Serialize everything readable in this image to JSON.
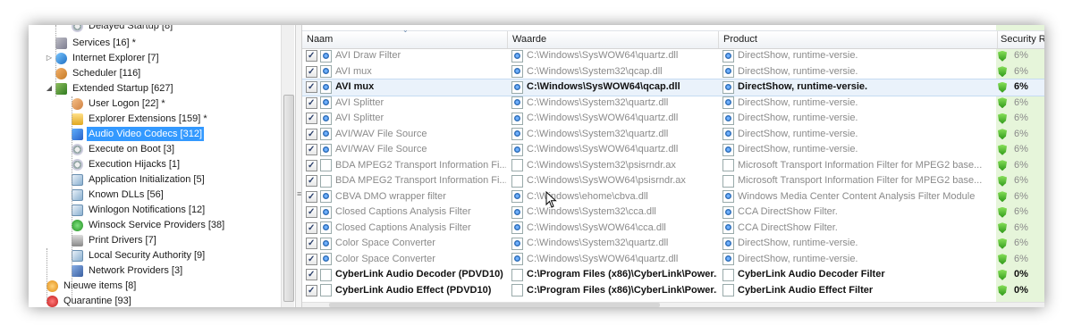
{
  "tree": {
    "items": [
      {
        "label": "Delayed Startup [8]",
        "icon": "gear-icon",
        "level": 2
      },
      {
        "label": "Services [16] *",
        "icon": "services-icon",
        "level": 1
      },
      {
        "label": "Internet Explorer [7]",
        "icon": "internet-explorer-icon",
        "level": 1,
        "expander": "▷"
      },
      {
        "label": "Scheduler [116]",
        "icon": "scheduler-icon",
        "level": 1
      },
      {
        "label": "Extended Startup [627]",
        "icon": "extended-startup-icon",
        "level": 1,
        "expander": "◢"
      },
      {
        "label": "User Logon [22] *",
        "icon": "user-icon",
        "level": 2
      },
      {
        "label": "Explorer Extensions [159] *",
        "icon": "folder-icon",
        "level": 2
      },
      {
        "label": "Audio Video Codecs [312]",
        "icon": "audio-video-icon",
        "level": 2,
        "selected": true
      },
      {
        "label": "Execute on Boot [3]",
        "icon": "gear-icon",
        "level": 2
      },
      {
        "label": "Execution Hijacks [1]",
        "icon": "gear-icon",
        "level": 2
      },
      {
        "label": "Application Initialization [5]",
        "icon": "dll-icon",
        "level": 2
      },
      {
        "label": "Known DLLs [56]",
        "icon": "dll-icon",
        "level": 2
      },
      {
        "label": "Winlogon Notifications [12]",
        "icon": "dll-icon",
        "level": 2
      },
      {
        "label": "Winsock Service Providers [38]",
        "icon": "winsock-icon",
        "level": 2
      },
      {
        "label": "Print Drivers [7]",
        "icon": "printer-icon",
        "level": 2
      },
      {
        "label": "Local Security Authority [9]",
        "icon": "dll-icon",
        "level": 2
      },
      {
        "label": "Network Providers [3]",
        "icon": "network-icon",
        "level": 2
      },
      {
        "label": "Nieuwe items [8]",
        "icon": "new-items-icon",
        "level": 0
      },
      {
        "label": "Quarantine [93]",
        "icon": "quarantine-icon",
        "level": 0
      }
    ]
  },
  "list": {
    "columns": [
      "Naam",
      "Waarde",
      "Product",
      "Security Ri"
    ],
    "rows": [
      {
        "name": "AVI Draw Filter",
        "value": "C:\\Windows\\SysWOW64\\quartz.dll",
        "product": "DirectShow, runtime-versie.",
        "security": "6%",
        "style": "dim",
        "file_icon": "img"
      },
      {
        "name": "AVI mux",
        "value": "C:\\Windows\\System32\\qcap.dll",
        "product": "DirectShow, runtime-versie.",
        "security": "6%",
        "style": "dim",
        "file_icon": "img"
      },
      {
        "name": "AVI mux",
        "value": "C:\\Windows\\SysWOW64\\qcap.dll",
        "product": "DirectShow, runtime-versie.",
        "security": "6%",
        "style": "highlight",
        "file_icon": "img"
      },
      {
        "name": "AVI Splitter",
        "value": "C:\\Windows\\System32\\quartz.dll",
        "product": "DirectShow, runtime-versie.",
        "security": "6%",
        "style": "dim",
        "file_icon": "img"
      },
      {
        "name": "AVI Splitter",
        "value": "C:\\Windows\\SysWOW64\\quartz.dll",
        "product": "DirectShow, runtime-versie.",
        "security": "6%",
        "style": "dim",
        "file_icon": "img"
      },
      {
        "name": "AVI/WAV File Source",
        "value": "C:\\Windows\\System32\\quartz.dll",
        "product": "DirectShow, runtime-versie.",
        "security": "6%",
        "style": "dim",
        "file_icon": "img"
      },
      {
        "name": "AVI/WAV File Source",
        "value": "C:\\Windows\\SysWOW64\\quartz.dll",
        "product": "DirectShow, runtime-versie.",
        "security": "6%",
        "style": "dim",
        "file_icon": "img"
      },
      {
        "name": "BDA MPEG2 Transport Information Fi...",
        "value": "C:\\Windows\\System32\\psisrndr.ax",
        "product": "Microsoft Transport Information Filter for MPEG2 base...",
        "security": "6%",
        "style": "dim",
        "file_icon": "blank"
      },
      {
        "name": "BDA MPEG2 Transport Information Fi...",
        "value": "C:\\Windows\\SysWOW64\\psisrndr.ax",
        "product": "Microsoft Transport Information Filter for MPEG2 base...",
        "security": "6%",
        "style": "dim",
        "file_icon": "blank"
      },
      {
        "name": "CBVA DMO wrapper filter",
        "value": "C:\\Windows\\ehome\\cbva.dll",
        "product": "Windows Media Center Content Analysis Filter Module",
        "security": "6%",
        "style": "dim",
        "file_icon": "img"
      },
      {
        "name": "Closed Captions Analysis Filter",
        "value": "C:\\Windows\\System32\\cca.dll",
        "product": "CCA DirectShow Filter.",
        "security": "6%",
        "style": "dim",
        "file_icon": "img"
      },
      {
        "name": "Closed Captions Analysis Filter",
        "value": "C:\\Windows\\SysWOW64\\cca.dll",
        "product": "CCA DirectShow Filter.",
        "security": "6%",
        "style": "dim",
        "file_icon": "img"
      },
      {
        "name": "Color Space Converter",
        "value": "C:\\Windows\\System32\\quartz.dll",
        "product": "DirectShow, runtime-versie.",
        "security": "6%",
        "style": "dim",
        "file_icon": "img"
      },
      {
        "name": "Color Space Converter",
        "value": "C:\\Windows\\SysWOW64\\quartz.dll",
        "product": "DirectShow, runtime-versie.",
        "security": "6%",
        "style": "dim",
        "file_icon": "img"
      },
      {
        "name": "CyberLink Audio Decoder (PDVD10)",
        "value": "C:\\Program Files (x86)\\CyberLink\\Power...",
        "product": "CyberLink Audio Decoder Filter",
        "security": "0%",
        "style": "active",
        "file_icon": "blank"
      },
      {
        "name": "CyberLink Audio Effect (PDVD10)",
        "value": "C:\\Program Files (x86)\\CyberLink\\Power...",
        "product": "CyberLink Audio Effect Filter",
        "security": "0%",
        "style": "active",
        "file_icon": "blank"
      }
    ]
  }
}
